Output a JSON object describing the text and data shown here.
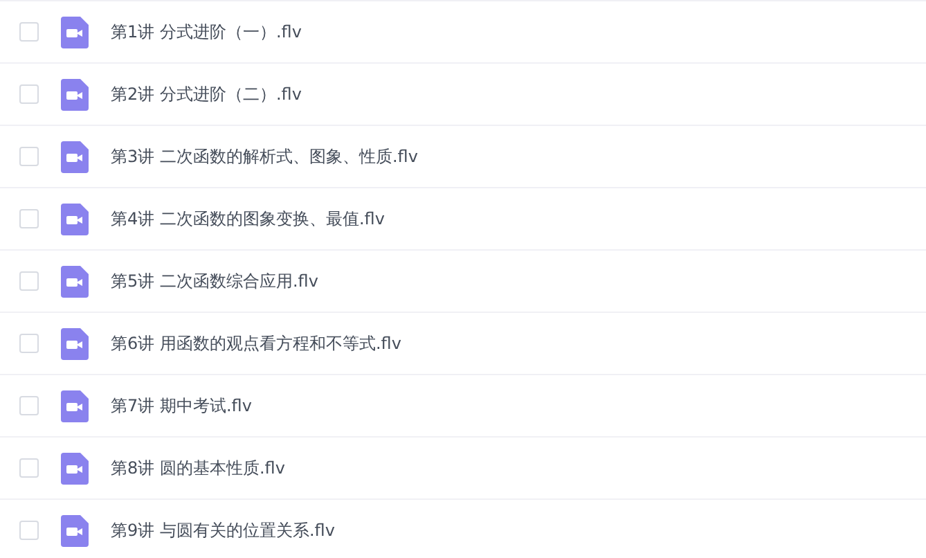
{
  "files": [
    {
      "name": "第1讲 分式进阶（一）.flv",
      "checked": false
    },
    {
      "name": "第2讲 分式进阶（二）.flv",
      "checked": false
    },
    {
      "name": "第3讲 二次函数的解析式、图象、性质.flv",
      "checked": false
    },
    {
      "name": "第4讲 二次函数的图象变换、最值.flv",
      "checked": false
    },
    {
      "name": "第5讲 二次函数综合应用.flv",
      "checked": false
    },
    {
      "name": "第6讲 用函数的观点看方程和不等式.flv",
      "checked": false
    },
    {
      "name": "第7讲 期中考试.flv",
      "checked": false
    },
    {
      "name": "第8讲 圆的基本性质.flv",
      "checked": false
    },
    {
      "name": "第9讲 与圆有关的位置关系.flv",
      "checked": false
    }
  ]
}
